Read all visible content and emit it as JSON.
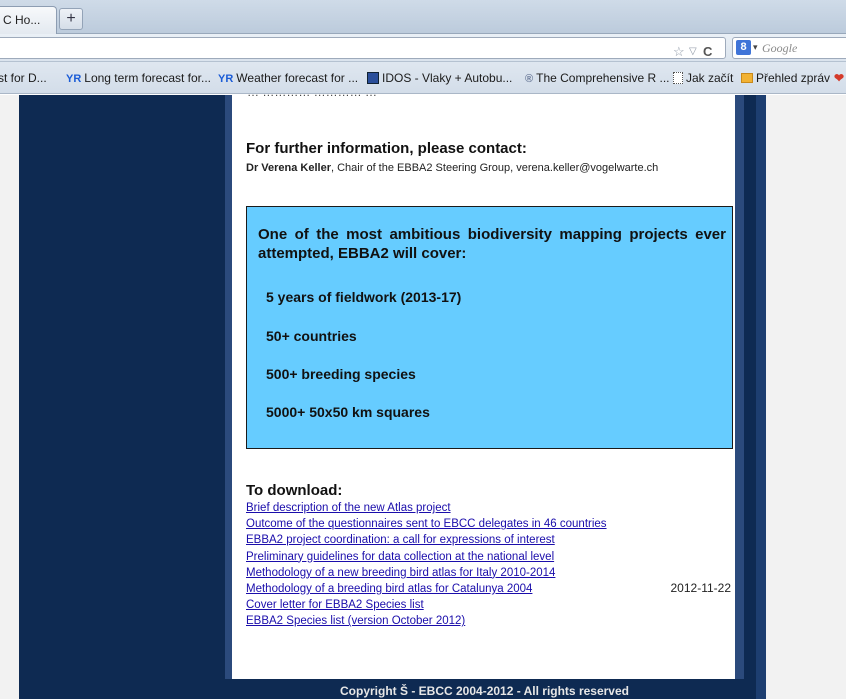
{
  "browser": {
    "tab_title": "C Ho...",
    "new_tab_symbol": "+",
    "search_engine_badge": "8",
    "search_placeholder": "Google",
    "bookmarks": [
      {
        "label": "st for D...",
        "icon": ""
      },
      {
        "label": "Long term forecast for...",
        "icon": "YR"
      },
      {
        "label": "Weather forecast for ...",
        "icon": "YR"
      },
      {
        "label": "IDOS - Vlaky + Autobu...",
        "icon": "book-icon"
      },
      {
        "label": "The Comprehensive R ...",
        "icon": "r-icon"
      },
      {
        "label": "Jak začít",
        "icon": "page-icon"
      },
      {
        "label": "Přehled zpráv",
        "icon": "folder-icon"
      }
    ]
  },
  "page": {
    "cut_text": "… ………… ………… …",
    "contact_heading": "For further information, please contact:",
    "contact_name": "Dr Verena Keller",
    "contact_rest": ", Chair of the EBBA2 Steering Group, verena.keller@vogelwarte.ch",
    "infobox_intro": "One of the most ambitious biodiversity mapping projects ever attempted, EBBA2 will cover:",
    "facts": [
      "5 years of fieldwork (2013-17)",
      "50+ countries",
      "500+ breeding species",
      "5000+ 50x50 km squares"
    ],
    "download_heading": "To download:",
    "downloads": [
      "Brief description of the new Atlas project",
      "Outcome of the questionnaires sent to EBCC delegates in 46 countries",
      "EBBA2 project coordination: a call for expressions of interest",
      "Preliminary guidelines for data collection at the national level",
      "Methodology of a new breeding bird atlas for Italy 2010-2014",
      "Methodology of a breeding bird atlas for Catalunya 2004",
      "Cover letter for EBBA2 Species list",
      "EBBA2 Species list (version October 2012)"
    ],
    "date": "2012-11-22",
    "footer": "Copyright Š - EBCC 2004-2012 - All rights reserved"
  },
  "colors": {
    "navy": "#0e2a52",
    "infobox": "#66ccff",
    "link": "#1a0dab"
  }
}
